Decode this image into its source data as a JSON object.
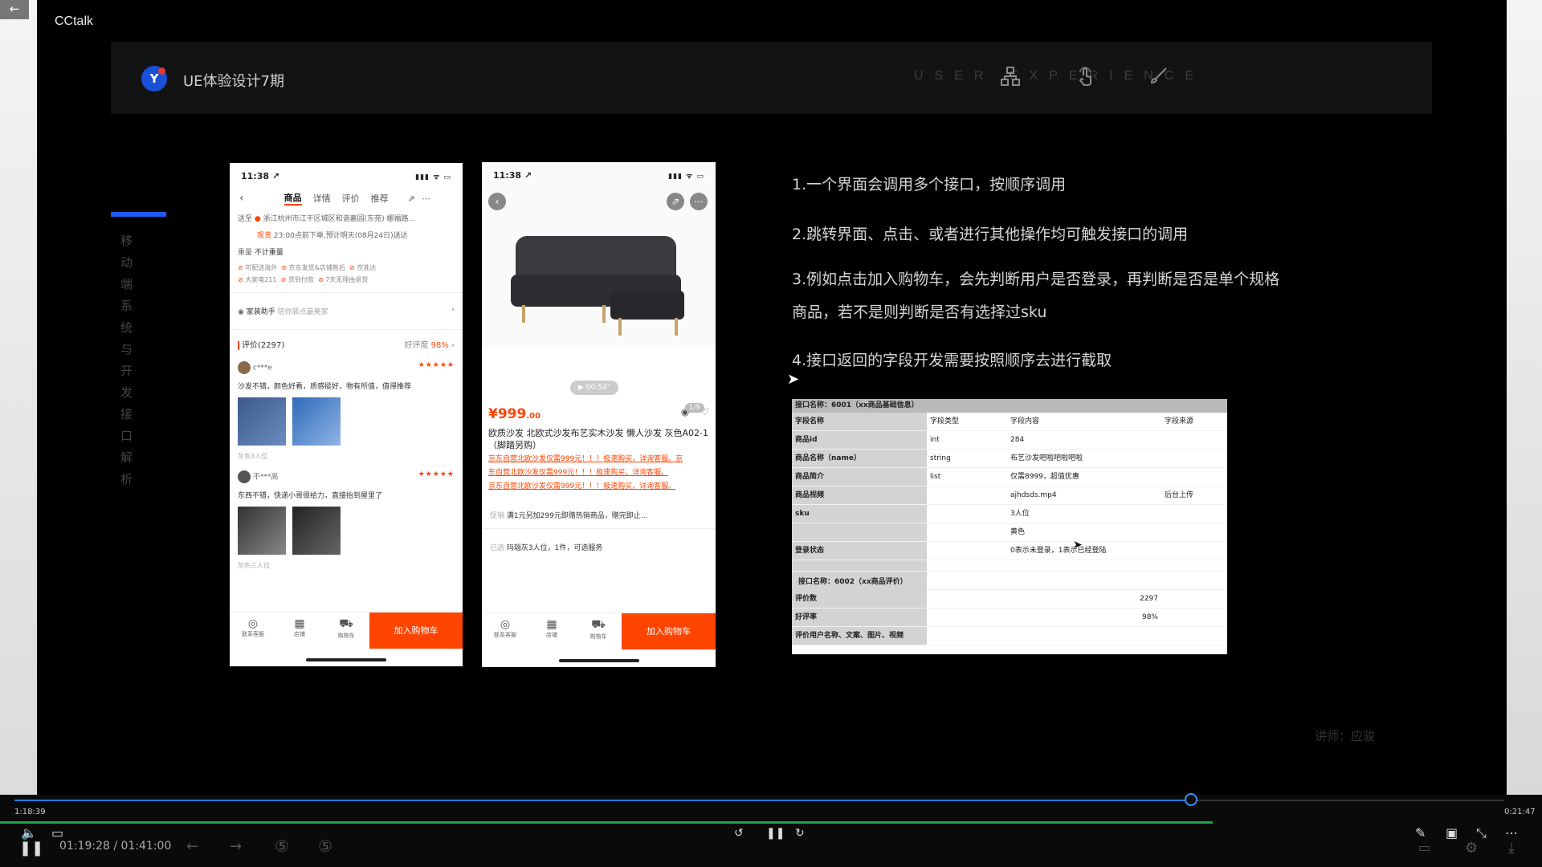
{
  "app": {
    "name": "CCtalk",
    "back": "←"
  },
  "header": {
    "logo_letter": "Y",
    "title": "UE体验设计7期",
    "ux_text": "USER EXPERIENCE"
  },
  "side_title": "移动端系统与开发接口解析",
  "phone1": {
    "time": "11:38 ↗",
    "signal": "▮▮▮ ᯤ ▭",
    "tabs": [
      "商品",
      "详情",
      "评价",
      "推荐"
    ],
    "address_label": "送至",
    "address": "浙江杭州市江干区城区和谐嘉园(东苑)·娜福路…",
    "delivery_note": "现货",
    "delivery": "23:00点前下单,预计明天(08月24日)送达",
    "weight_label": "重量",
    "weight": "不计重量",
    "tags": [
      "可配送海外",
      "京东发货&店铺售后",
      "京准达",
      "大家电211",
      "货到付款",
      "7天无理由退货"
    ],
    "helper_title": "家装助手",
    "helper_sub": "陪你装点最美家",
    "reviews_title": "评价(2297)",
    "good_rate_label": "好评度",
    "good_rate": "98%",
    "review1_user": "c***e",
    "review1_text": "沙发不错，颜色好看，质感挺好，物有所值，值得推荐",
    "review1_spec": "灰色3人位",
    "review2_user": "不***高",
    "review2_text": "东西不错，快递小哥很给力，直接抬到屋里了",
    "review2_spec": "灰色三人位",
    "stars": "★★★★★",
    "bottom": [
      {
        "icon": "◎",
        "label": "联系客服"
      },
      {
        "icon": "▦",
        "label": "店铺"
      },
      {
        "icon": "⛟",
        "label": "购物车"
      }
    ],
    "cart_button": "加入购物车"
  },
  "phone2": {
    "time": "11:38 ↗",
    "signal": "▮▮▮ ᯤ ▭",
    "video": "▶ 00:54\"",
    "page": "1/9",
    "price": "¥999",
    "price_cents": ".00",
    "title": "欧质沙发 北欧式沙发布艺实木沙发 懒人沙发 灰色A02-1（脚踏另购）",
    "promo": [
      "京东自营北欧沙发仅需999元！！！极速购买，详询客服。京",
      "东自营北欧沙发仅需999元！！！极速购买，详询客服。",
      "京东自营北欧沙发仅需999元！！！极速购买，详询客服。"
    ],
    "offer_label": "促销",
    "offer": "满1元另加299元即赠热销商品，赠完即止…",
    "selected_label": "已选",
    "selected": "玛瑙灰3人位，1件，可选服务",
    "bottom": [
      {
        "icon": "◎",
        "label": "联系客服"
      },
      {
        "icon": "▦",
        "label": "店铺"
      },
      {
        "icon": "⛟",
        "label": "购物车"
      }
    ],
    "cart_button": "加入购物车"
  },
  "notes": [
    "1.一个界面会调用多个接口，按顺序调用",
    "2.跳转界面、点击、或者进行其他操作均可触发接口的调用",
    "3.例如点击加入购物车，会先判断用户是否登录，再判断是否是单个规格",
    "商品，若不是则判断是否有选择过sku",
    "4.接口返回的字段开发需要按照顺序去进行截取"
  ],
  "api_table": {
    "title1": "接口名称：6001（xx商品基础信息）",
    "columns": [
      "字段名称",
      "字段类型",
      "字段内容",
      "字段来源"
    ],
    "rows1": [
      [
        "商品id",
        "int",
        "284",
        ""
      ],
      [
        "商品名称（name）",
        "string",
        "布艺沙发吧啦吧啦吧啦",
        ""
      ],
      [
        "商品简介",
        "list",
        "仅需8999，超值优惠",
        ""
      ],
      [
        "商品视频",
        "",
        "ajhdsds.mp4",
        "后台上传"
      ],
      [
        "sku",
        "",
        "3人位",
        ""
      ],
      [
        "",
        "",
        "黄色",
        ""
      ],
      [
        "登录状态",
        "",
        "0表示未登录，1表示已经登陆",
        ""
      ]
    ],
    "title2": "接口名称：6002（xx商品评价）",
    "rows2": [
      [
        "评价数",
        "",
        "",
        "2297"
      ],
      [
        "好评率",
        "",
        "",
        "98%"
      ],
      [
        "评价用户名称、文案、图片、视频",
        "",
        "",
        ""
      ]
    ]
  },
  "lecturer": "讲师：应骏",
  "player": {
    "elapsed_small": "1:18:39",
    "total_small": "0:21:47",
    "time_display": "01:19:28 / 01:41:00",
    "progress": 0.79
  }
}
